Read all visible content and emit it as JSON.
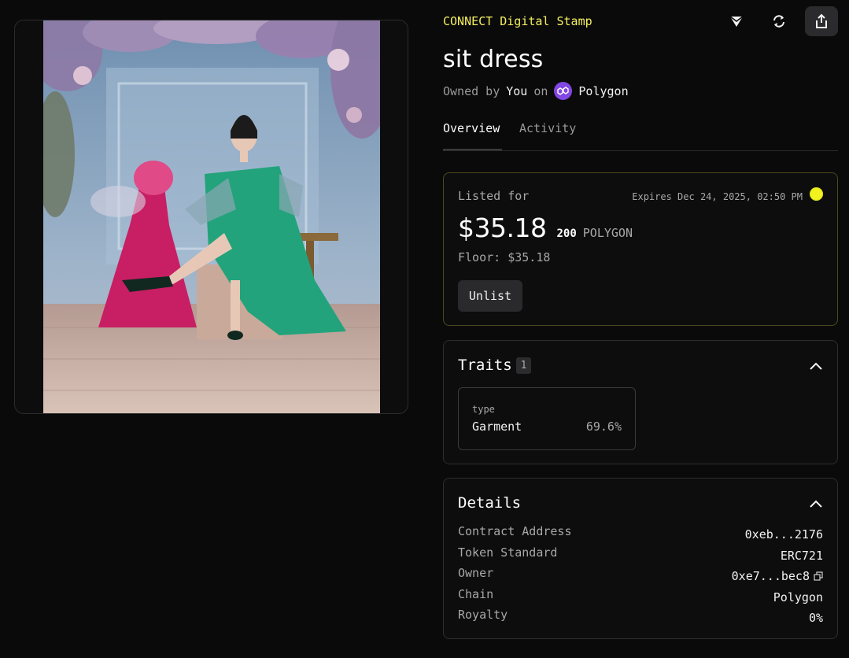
{
  "collection": "CONNECT Digital Stamp",
  "title": "sit dress",
  "owner_line": {
    "prefix": "Owned by",
    "owner": "You",
    "middle": "on",
    "chain": "Polygon"
  },
  "tabs": [
    {
      "label": "Overview",
      "active": true
    },
    {
      "label": "Activity",
      "active": false
    }
  ],
  "actions": {
    "icons": [
      "transfer-icon",
      "refresh-icon",
      "share-icon"
    ]
  },
  "listing": {
    "label": "Listed for",
    "expires": "Expires Dec 24, 2025, 02:50 PM",
    "price": "$35.18",
    "amount": "200",
    "currency": "POLYGON",
    "floor": "Floor: $35.18",
    "unlist_label": "Unlist"
  },
  "traits": {
    "title": "Traits",
    "count": "1",
    "items": [
      {
        "type": "type",
        "value": "Garment",
        "percent": "69.6%"
      }
    ]
  },
  "details": {
    "title": "Details",
    "rows": [
      {
        "key": "Contract Address",
        "value": "0xeb...2176"
      },
      {
        "key": "Token Standard",
        "value": "ERC721"
      },
      {
        "key": "Owner",
        "value": "0xe7...bec8"
      },
      {
        "key": "Chain",
        "value": "Polygon"
      },
      {
        "key": "Royalty",
        "value": "0%"
      }
    ]
  },
  "colors": {
    "accent_yellow": "#f6f05f",
    "polygon_purple": "#8247e5",
    "status_dot": "#f2f220"
  }
}
